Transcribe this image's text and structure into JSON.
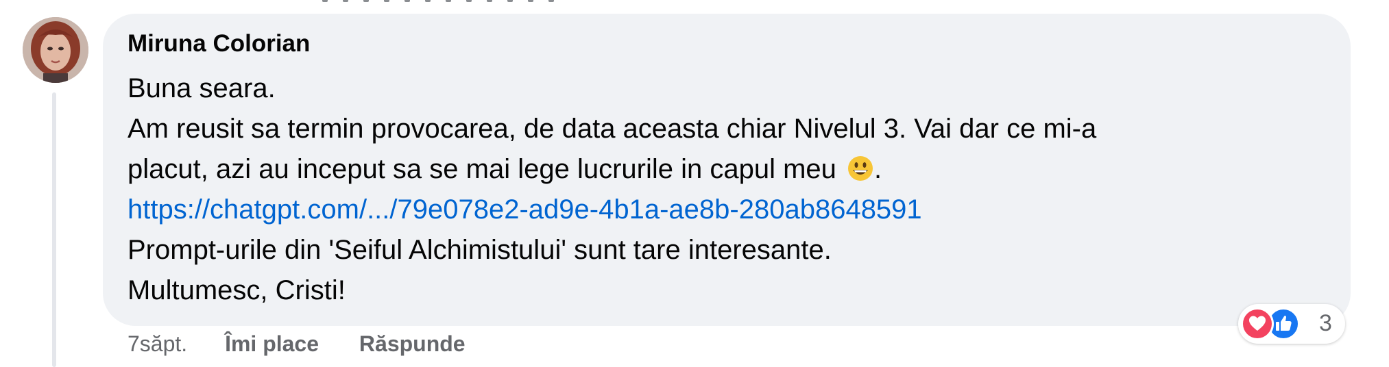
{
  "comment": {
    "author": "Miruna Colorian",
    "lines": [
      "Buna seara.",
      "Am reusit sa termin provocarea, de data aceasta chiar Nivelul 3. Vai dar ce mi-a",
      "placut, azi au inceput sa se mai lege lucrurile in capul meu"
    ],
    "line3_suffix": ".",
    "emoji": "grinning-face",
    "link": "https://chatgpt.com/.../79e078e2-ad9e-4b1a-ae8b-280ab8648591",
    "after_link_lines": [
      "Prompt-urile din 'Seiful Alchimistului' sunt tare interesante.",
      "Multumesc, Cristi!"
    ]
  },
  "actions": {
    "time": "7săpt.",
    "like_label": "Îmi place",
    "reply_label": "Răspunde"
  },
  "reactions": {
    "icons": [
      "love-icon",
      "like-icon"
    ],
    "count": "3"
  },
  "colors": {
    "bubble": "#f0f2f5",
    "link": "#0064d1",
    "secondary_text": "#65676b",
    "love": "#f3425f",
    "like": "#1877f2"
  }
}
